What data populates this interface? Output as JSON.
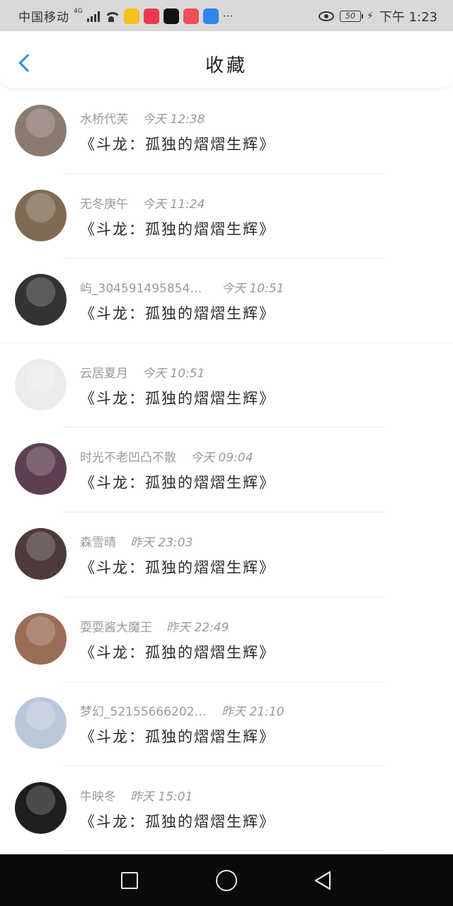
{
  "status_bar": {
    "carrier": "中国移动",
    "network": "4G",
    "battery": "50",
    "time": "下午 1:23",
    "more": "···",
    "apps": [
      {
        "name": "app-icon-1",
        "color": "#f3c21f",
        "label": ""
      },
      {
        "name": "app-icon-2",
        "color": "#e83b4f",
        "label": ""
      },
      {
        "name": "app-icon-3",
        "color": "#111111",
        "label": ""
      },
      {
        "name": "app-icon-4",
        "color": "#ee4d5a",
        "label": ""
      },
      {
        "name": "app-icon-5",
        "color": "#2f86e8",
        "label": ""
      }
    ]
  },
  "nav": {
    "back_icon": "chevron-left-icon",
    "title": "收藏"
  },
  "colors": {
    "accent": "#2a8cf0",
    "meta": "#9a9a9a",
    "text": "#2b2b2b"
  },
  "items": [
    {
      "name": "水桥代芙",
      "time": "今天 12:38",
      "content": "《斗龙：孤独的熠熠生辉》",
      "avatar_color": "#8b7a6e"
    },
    {
      "name": "无冬庚午",
      "time": "今天 11:24",
      "content": "《斗龙：孤独的熠熠生辉》",
      "avatar_color": "#7f6b55"
    },
    {
      "name": "屿_30459149585453…",
      "time": "今天 10:51",
      "content": "《斗龙：孤独的熠熠生辉》",
      "avatar_color": "#333333"
    },
    {
      "name": "云居夏月",
      "time": "今天 10:51",
      "content": "《斗龙：孤独的熠熠生辉》",
      "avatar_color": "#ececec"
    },
    {
      "name": "时光不老凹凸不散",
      "time": "今天 09:04",
      "content": "《斗龙：孤独的熠熠生辉》",
      "avatar_color": "#5c3f50"
    },
    {
      "name": "森雪晴",
      "time": "昨天 23:03",
      "content": "《斗龙：孤独的熠熠生辉》",
      "avatar_color": "#4d3a3a"
    },
    {
      "name": "耍耍酱大魔王",
      "time": "昨天 22:49",
      "content": "《斗龙：孤独的熠熠生辉》",
      "avatar_color": "#9a6d57"
    },
    {
      "name": "梦幻_521556662020…",
      "time": "昨天 21:10",
      "content": "《斗龙：孤独的熠熠生辉》",
      "avatar_color": "#b9c8d8"
    },
    {
      "name": "牛映冬",
      "time": "昨天 15:01",
      "content": "《斗龙：孤独的熠熠生辉》",
      "avatar_color": "#1e1e1e"
    }
  ],
  "system_nav": {
    "recent": "square-icon",
    "home": "circle-icon",
    "back": "triangle-back-icon"
  }
}
